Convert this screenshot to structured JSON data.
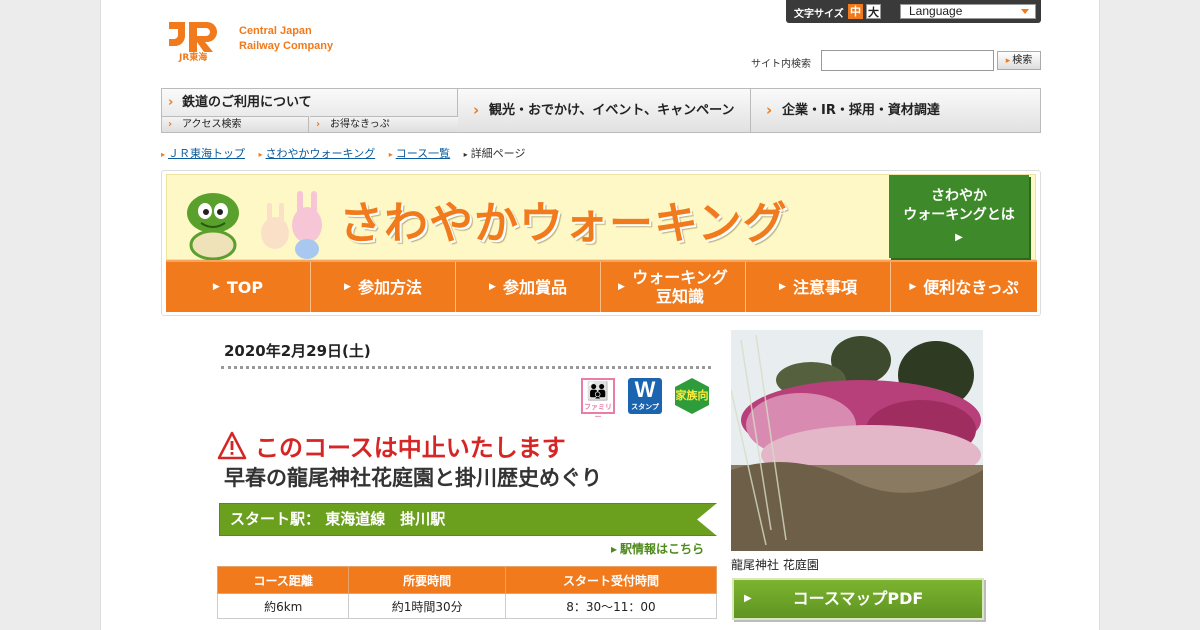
{
  "header": {
    "logo_line1": "Central Japan",
    "logo_line2": "Railway Company",
    "logo_mark": "JR東海",
    "font_size_label": "文字サイズ",
    "font_size_mid": "中",
    "font_size_large": "大",
    "language_label": "Language",
    "search_label": "サイト内検索",
    "search_placeholder": "",
    "search_button": "検索"
  },
  "global_nav": {
    "item1": "鉄道のご利用について",
    "sub1": "アクセス検索",
    "sub2": "お得なきっぷ",
    "item2": "観光・おでかけ、イベント、キャンペーン",
    "item3": "企業・IR・採用・資材調達"
  },
  "breadcrumb": {
    "items": [
      "ＪＲ東海トップ",
      "さわやかウォーキング",
      "コース一覧"
    ],
    "current": "詳細ページ"
  },
  "banner": {
    "title": "さわやかウォーキング",
    "what_line1": "さわやか",
    "what_line2": "ウォーキングとは",
    "nav": [
      "TOP",
      "参加方法",
      "参加賞品",
      "ウォーキング豆知識",
      "注意事項",
      "便利なきっぷ"
    ]
  },
  "course": {
    "date": "2020年2月29日(土)",
    "badges": {
      "family": "ファミリー",
      "stamp_letter": "W",
      "stamp": "スタンプ",
      "kazoku": "家族向"
    },
    "cancel_notice": "このコースは中止いたします",
    "title": "早春の龍尾神社花庭園と掛川歴史めぐり",
    "start_station": "スタート駅：  東海道線　掛川駅",
    "station_info_link": "駅情報はこちら",
    "table_headers": [
      "コース距離",
      "所要時間",
      "スタート受付時間"
    ],
    "table_values": [
      "約6km",
      "約1時間30分",
      "8：30～11：00"
    ],
    "photo_caption": "龍尾神社 花庭園",
    "map_pdf_button": "コースマップPDF"
  },
  "colors": {
    "accent_orange": "#f07a1c",
    "green": "#6b9f1e",
    "warning_red": "#d62525"
  }
}
